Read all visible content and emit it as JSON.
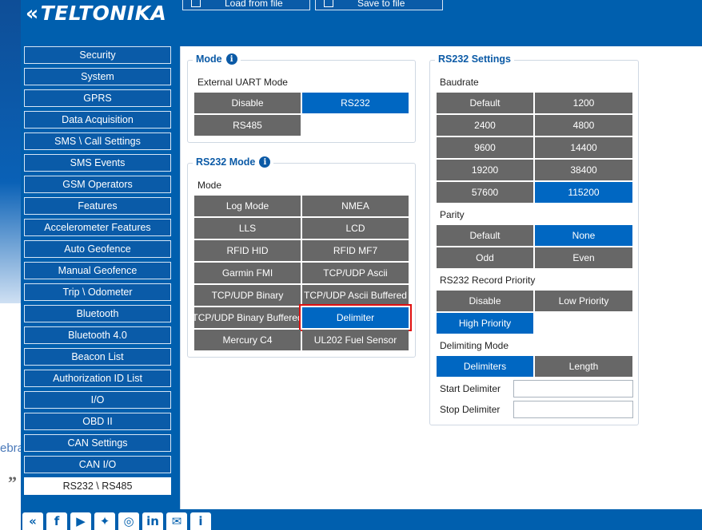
{
  "brand": {
    "logo_text": "TELTONIKA"
  },
  "background": {
    "side_text": "ebra",
    "quote_glyph": "”"
  },
  "toolbar": {
    "load_label": "Load from file",
    "save_label": "Save to file"
  },
  "sidebar": {
    "items": [
      {
        "label": "Security"
      },
      {
        "label": "System"
      },
      {
        "label": "GPRS"
      },
      {
        "label": "Data Acquisition"
      },
      {
        "label": "SMS \\ Call Settings"
      },
      {
        "label": "SMS Events"
      },
      {
        "label": "GSM Operators"
      },
      {
        "label": "Features"
      },
      {
        "label": "Accelerometer Features"
      },
      {
        "label": "Auto Geofence"
      },
      {
        "label": "Manual Geofence"
      },
      {
        "label": "Trip \\ Odometer"
      },
      {
        "label": "Bluetooth"
      },
      {
        "label": "Bluetooth 4.0"
      },
      {
        "label": "Beacon List"
      },
      {
        "label": "Authorization ID List"
      },
      {
        "label": "I/O"
      },
      {
        "label": "OBD II"
      },
      {
        "label": "CAN Settings"
      },
      {
        "label": "CAN I/O"
      },
      {
        "label": "RS232 \\ RS485"
      }
    ],
    "active": "RS232 \\ RS485"
  },
  "mode_group": {
    "title": "Mode",
    "sub_label": "External UART Mode",
    "options": [
      "Disable",
      "RS232",
      "RS485"
    ],
    "selected": "RS232"
  },
  "rs232_mode_group": {
    "title": "RS232 Mode",
    "sub_label": "Mode",
    "options": [
      "Log Mode",
      "NMEA",
      "LLS",
      "LCD",
      "RFID HID",
      "RFID MF7",
      "Garmin FMI",
      "TCP/UDP Ascii",
      "TCP/UDP Binary",
      "TCP/UDP Ascii Buffered",
      "TCP/UDP Binary Buffered",
      "Delimiter",
      "Mercury C4",
      "UL202 Fuel Sensor"
    ],
    "selected": "Delimiter"
  },
  "rs232_settings": {
    "title": "RS232 Settings",
    "baudrate": {
      "label": "Baudrate",
      "options": [
        "Default",
        "1200",
        "2400",
        "4800",
        "9600",
        "14400",
        "19200",
        "38400",
        "57600",
        "115200"
      ],
      "selected": "115200"
    },
    "parity": {
      "label": "Parity",
      "options": [
        "Default",
        "None",
        "Odd",
        "Even"
      ],
      "selected": "None"
    },
    "record_priority": {
      "label": "RS232 Record Priority",
      "options": [
        "Disable",
        "Low Priority",
        "High Priority"
      ],
      "selected": "High Priority"
    },
    "delimiting_mode": {
      "label": "Delimiting Mode",
      "options": [
        "Delimiters",
        "Length"
      ],
      "selected": "Delimiters"
    },
    "start_delimiter": {
      "label": "Start Delimiter",
      "value": ""
    },
    "stop_delimiter": {
      "label": "Stop Delimiter",
      "value": ""
    }
  },
  "footer": {
    "icons": [
      "teltonika-icon",
      "facebook-icon",
      "youtube-icon",
      "twitter-icon",
      "instagram-icon",
      "linkedin-icon",
      "chat-icon",
      "info-icon"
    ]
  }
}
